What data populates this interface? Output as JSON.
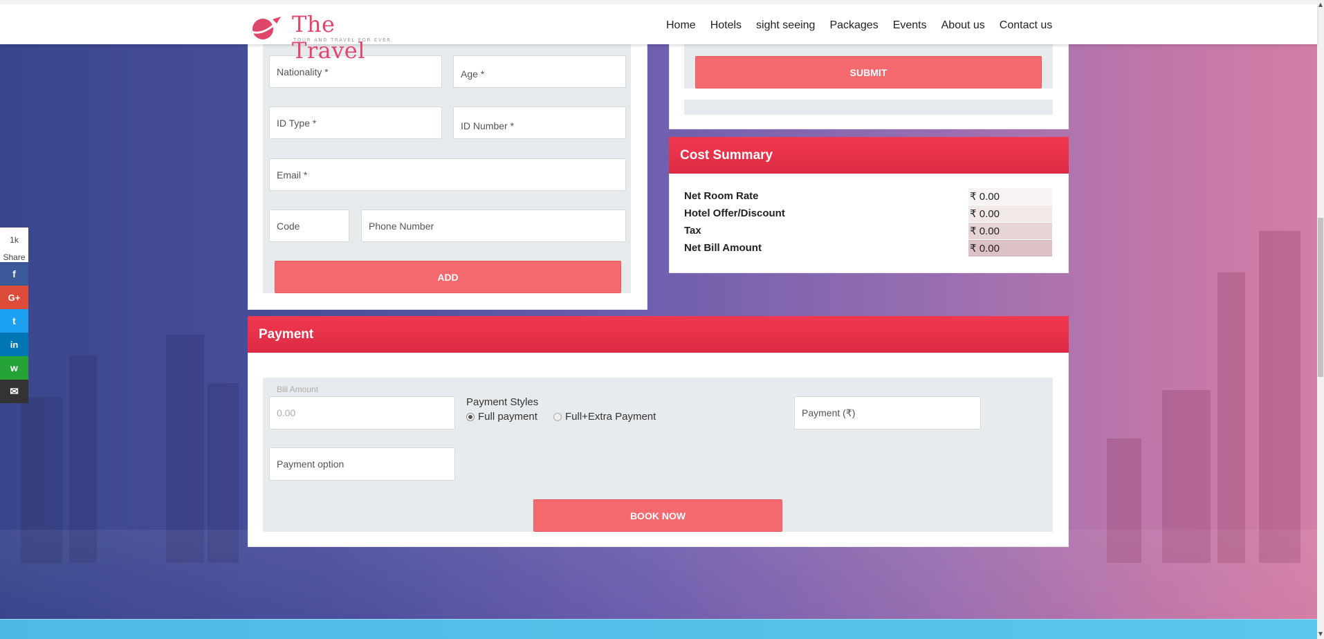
{
  "brand": {
    "title": "The Travel",
    "tagline": "TOUR AND TRAVEL FOR EVER",
    "color": "#e0456a"
  },
  "nav": [
    "Home",
    "Hotels",
    "sight seeing",
    "Packages",
    "Events",
    "About us",
    "Contact us"
  ],
  "guest_form": {
    "nationality_placeholder": "Nationality *",
    "age_placeholder": "Age *",
    "id_type_placeholder": "ID Type *",
    "id_number_placeholder": "ID Number *",
    "email_placeholder": "Email *",
    "code_placeholder": "Code",
    "phone_placeholder": "Phone Number",
    "add_label": "ADD"
  },
  "submit_label": "SUBMIT",
  "cost_summary": {
    "title": "Cost Summary",
    "rows": [
      {
        "label": "Net Room Rate",
        "value": "₹ 0.00"
      },
      {
        "label": "Hotel Offer/Discount",
        "value": "₹ 0.00"
      },
      {
        "label": "Tax",
        "value": "₹ 0.00"
      },
      {
        "label": "Net Bill Amount",
        "value": "₹ 0.00"
      }
    ]
  },
  "payment": {
    "title": "Payment",
    "bill_amount_label": "Bill Amount",
    "bill_amount_value": "0.00",
    "styles_label": "Payment Styles",
    "style_full": "Full payment",
    "style_full_extra": "Full+Extra Payment",
    "selected_style": "Full payment",
    "payment_placeholder": "Payment (₹)",
    "payment_option_placeholder": "Payment option",
    "book_label": "BOOK NOW"
  },
  "share": {
    "count": "1k",
    "label": "Share",
    "buttons": [
      {
        "name": "facebook",
        "glyph": "f",
        "color": "#3b5998"
      },
      {
        "name": "google-plus",
        "glyph": "G+",
        "color": "#dd4b39"
      },
      {
        "name": "twitter",
        "glyph": "t",
        "color": "#1da1f2"
      },
      {
        "name": "linkedin",
        "glyph": "in",
        "color": "#0077b5"
      },
      {
        "name": "whatsapp",
        "glyph": "w",
        "color": "#25a336"
      },
      {
        "name": "email",
        "glyph": "✉",
        "color": "#333333"
      }
    ]
  },
  "colors": {
    "accent_red": "#e4304b",
    "button_red": "#f46a6f"
  }
}
